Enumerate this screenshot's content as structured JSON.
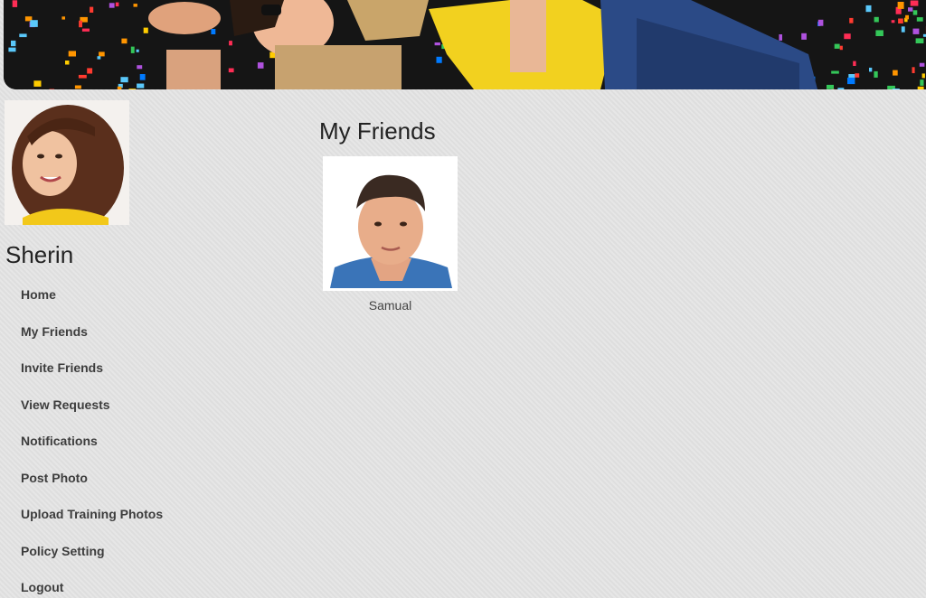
{
  "profile": {
    "name": "Sherin"
  },
  "nav": {
    "items": [
      {
        "label": "Home"
      },
      {
        "label": "My Friends"
      },
      {
        "label": "Invite Friends"
      },
      {
        "label": "View Requests"
      },
      {
        "label": "Notifications"
      },
      {
        "label": "Post Photo"
      },
      {
        "label": "Upload Training Photos"
      },
      {
        "label": "Policy Setting"
      },
      {
        "label": "Logout"
      }
    ]
  },
  "main": {
    "title": "My Friends",
    "friends": [
      {
        "name": "Samual"
      }
    ]
  }
}
